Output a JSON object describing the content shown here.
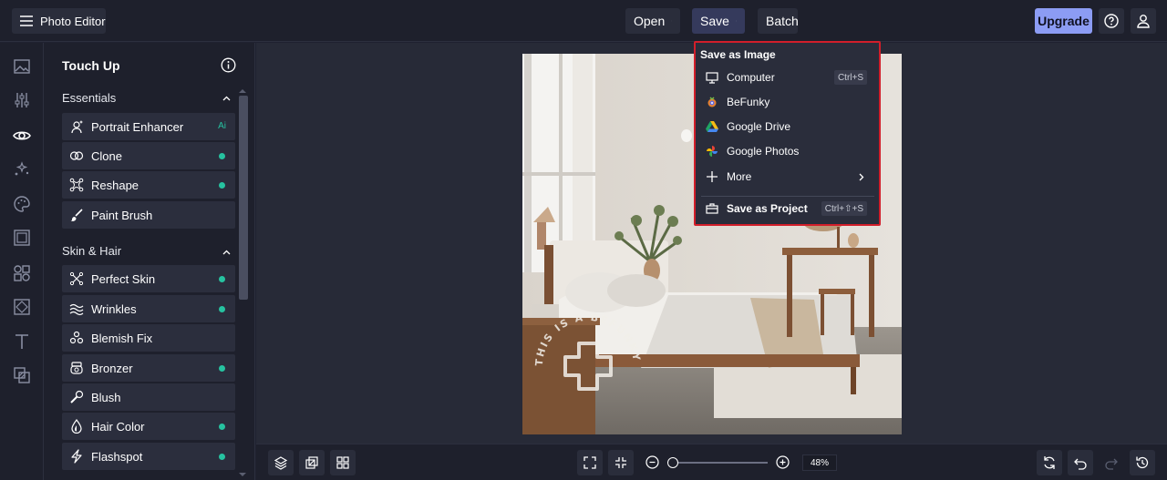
{
  "app": {
    "title": "Photo Editor"
  },
  "header": {
    "open_label": "Open",
    "save_label": "Save",
    "batch_label": "Batch",
    "upgrade_label": "Upgrade"
  },
  "rail": {
    "icons": [
      "image-icon",
      "adjust-icon",
      "eye-icon",
      "effects-icon",
      "palette-icon",
      "frame-icon",
      "graphics-icon",
      "texture-icon",
      "text-icon",
      "overlay-icon"
    ],
    "active": "eye-icon"
  },
  "panel": {
    "title": "Touch Up",
    "sections": [
      {
        "name": "Essentials",
        "items": [
          {
            "label": "Portrait Enhancer",
            "badge": "Ai"
          },
          {
            "label": "Clone",
            "badge": "dot"
          },
          {
            "label": "Reshape",
            "badge": "dot"
          },
          {
            "label": "Paint Brush",
            "badge": ""
          }
        ]
      },
      {
        "name": "Skin & Hair",
        "items": [
          {
            "label": "Perfect Skin",
            "badge": "dot"
          },
          {
            "label": "Wrinkles",
            "badge": "dot"
          },
          {
            "label": "Blemish Fix",
            "badge": ""
          },
          {
            "label": "Bronzer",
            "badge": "dot"
          },
          {
            "label": "Blush",
            "badge": ""
          },
          {
            "label": "Hair Color",
            "badge": "dot"
          },
          {
            "label": "Flashspot",
            "badge": "dot"
          }
        ]
      }
    ]
  },
  "save_menu": {
    "title": "Save as Image",
    "items": [
      {
        "label": "Computer",
        "shortcut": "Ctrl+S",
        "icon": "monitor-icon"
      },
      {
        "label": "BeFunky",
        "shortcut": "",
        "icon": "befunky-icon"
      },
      {
        "label": "Google Drive",
        "shortcut": "",
        "icon": "google-drive-icon"
      },
      {
        "label": "Google Photos",
        "shortcut": "",
        "icon": "google-photos-icon"
      },
      {
        "label": "More",
        "shortcut": "",
        "icon": "plus-icon"
      }
    ],
    "project_label": "Save as Project",
    "project_shortcut": "Ctrl+⇧+S"
  },
  "canvas": {
    "watermark": "THIS IS A BEFUNKY PLUS FEATURE"
  },
  "bottom": {
    "zoom": "48%",
    "zoom_level": 0.05
  },
  "colors": {
    "accent": "#8c9cf4",
    "status_dot": "#26c2a0",
    "menu_highlight_border": "#d21e2a"
  }
}
